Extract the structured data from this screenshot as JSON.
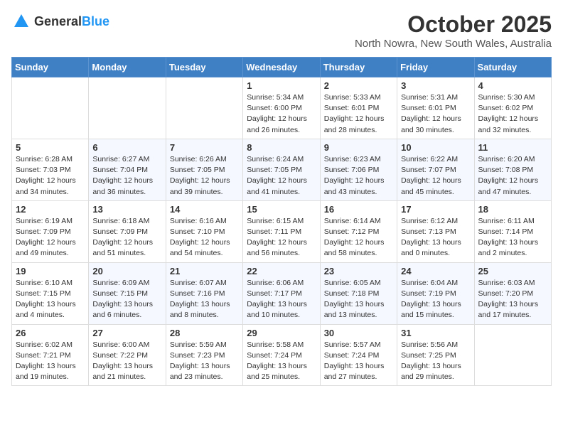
{
  "header": {
    "logo_general": "General",
    "logo_blue": "Blue",
    "month": "October 2025",
    "location": "North Nowra, New South Wales, Australia"
  },
  "days_of_week": [
    "Sunday",
    "Monday",
    "Tuesday",
    "Wednesday",
    "Thursday",
    "Friday",
    "Saturday"
  ],
  "weeks": [
    [
      {
        "day": "",
        "content": ""
      },
      {
        "day": "",
        "content": ""
      },
      {
        "day": "",
        "content": ""
      },
      {
        "day": "1",
        "content": "Sunrise: 5:34 AM\nSunset: 6:00 PM\nDaylight: 12 hours and 26 minutes."
      },
      {
        "day": "2",
        "content": "Sunrise: 5:33 AM\nSunset: 6:01 PM\nDaylight: 12 hours and 28 minutes."
      },
      {
        "day": "3",
        "content": "Sunrise: 5:31 AM\nSunset: 6:01 PM\nDaylight: 12 hours and 30 minutes."
      },
      {
        "day": "4",
        "content": "Sunrise: 5:30 AM\nSunset: 6:02 PM\nDaylight: 12 hours and 32 minutes."
      }
    ],
    [
      {
        "day": "5",
        "content": "Sunrise: 6:28 AM\nSunset: 7:03 PM\nDaylight: 12 hours and 34 minutes."
      },
      {
        "day": "6",
        "content": "Sunrise: 6:27 AM\nSunset: 7:04 PM\nDaylight: 12 hours and 36 minutes."
      },
      {
        "day": "7",
        "content": "Sunrise: 6:26 AM\nSunset: 7:05 PM\nDaylight: 12 hours and 39 minutes."
      },
      {
        "day": "8",
        "content": "Sunrise: 6:24 AM\nSunset: 7:05 PM\nDaylight: 12 hours and 41 minutes."
      },
      {
        "day": "9",
        "content": "Sunrise: 6:23 AM\nSunset: 7:06 PM\nDaylight: 12 hours and 43 minutes."
      },
      {
        "day": "10",
        "content": "Sunrise: 6:22 AM\nSunset: 7:07 PM\nDaylight: 12 hours and 45 minutes."
      },
      {
        "day": "11",
        "content": "Sunrise: 6:20 AM\nSunset: 7:08 PM\nDaylight: 12 hours and 47 minutes."
      }
    ],
    [
      {
        "day": "12",
        "content": "Sunrise: 6:19 AM\nSunset: 7:09 PM\nDaylight: 12 hours and 49 minutes."
      },
      {
        "day": "13",
        "content": "Sunrise: 6:18 AM\nSunset: 7:09 PM\nDaylight: 12 hours and 51 minutes."
      },
      {
        "day": "14",
        "content": "Sunrise: 6:16 AM\nSunset: 7:10 PM\nDaylight: 12 hours and 54 minutes."
      },
      {
        "day": "15",
        "content": "Sunrise: 6:15 AM\nSunset: 7:11 PM\nDaylight: 12 hours and 56 minutes."
      },
      {
        "day": "16",
        "content": "Sunrise: 6:14 AM\nSunset: 7:12 PM\nDaylight: 12 hours and 58 minutes."
      },
      {
        "day": "17",
        "content": "Sunrise: 6:12 AM\nSunset: 7:13 PM\nDaylight: 13 hours and 0 minutes."
      },
      {
        "day": "18",
        "content": "Sunrise: 6:11 AM\nSunset: 7:14 PM\nDaylight: 13 hours and 2 minutes."
      }
    ],
    [
      {
        "day": "19",
        "content": "Sunrise: 6:10 AM\nSunset: 7:15 PM\nDaylight: 13 hours and 4 minutes."
      },
      {
        "day": "20",
        "content": "Sunrise: 6:09 AM\nSunset: 7:15 PM\nDaylight: 13 hours and 6 minutes."
      },
      {
        "day": "21",
        "content": "Sunrise: 6:07 AM\nSunset: 7:16 PM\nDaylight: 13 hours and 8 minutes."
      },
      {
        "day": "22",
        "content": "Sunrise: 6:06 AM\nSunset: 7:17 PM\nDaylight: 13 hours and 10 minutes."
      },
      {
        "day": "23",
        "content": "Sunrise: 6:05 AM\nSunset: 7:18 PM\nDaylight: 13 hours and 13 minutes."
      },
      {
        "day": "24",
        "content": "Sunrise: 6:04 AM\nSunset: 7:19 PM\nDaylight: 13 hours and 15 minutes."
      },
      {
        "day": "25",
        "content": "Sunrise: 6:03 AM\nSunset: 7:20 PM\nDaylight: 13 hours and 17 minutes."
      }
    ],
    [
      {
        "day": "26",
        "content": "Sunrise: 6:02 AM\nSunset: 7:21 PM\nDaylight: 13 hours and 19 minutes."
      },
      {
        "day": "27",
        "content": "Sunrise: 6:00 AM\nSunset: 7:22 PM\nDaylight: 13 hours and 21 minutes."
      },
      {
        "day": "28",
        "content": "Sunrise: 5:59 AM\nSunset: 7:23 PM\nDaylight: 13 hours and 23 minutes."
      },
      {
        "day": "29",
        "content": "Sunrise: 5:58 AM\nSunset: 7:24 PM\nDaylight: 13 hours and 25 minutes."
      },
      {
        "day": "30",
        "content": "Sunrise: 5:57 AM\nSunset: 7:24 PM\nDaylight: 13 hours and 27 minutes."
      },
      {
        "day": "31",
        "content": "Sunrise: 5:56 AM\nSunset: 7:25 PM\nDaylight: 13 hours and 29 minutes."
      },
      {
        "day": "",
        "content": ""
      }
    ]
  ]
}
